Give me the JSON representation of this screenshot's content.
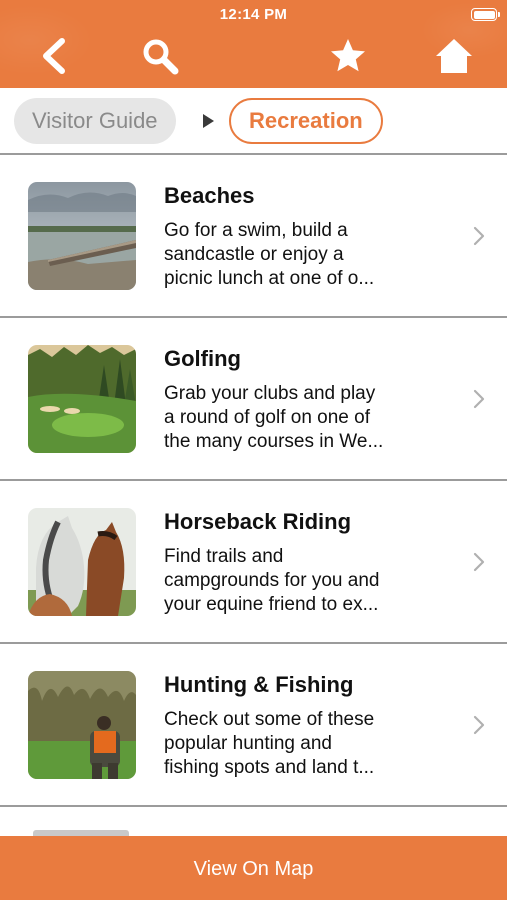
{
  "status": {
    "time": "12:14 PM"
  },
  "header": {
    "icons": [
      "back-chevron-icon",
      "search-icon",
      "star-icon",
      "home-icon"
    ],
    "color": "#e97b3f"
  },
  "breadcrumb": {
    "parent": "Visitor Guide",
    "current": "Recreation"
  },
  "items": [
    {
      "title": "Beaches",
      "desc_lines": [
        "Go for a swim, build a",
        "sandcastle or enjoy a",
        "picnic lunch at one of o..."
      ]
    },
    {
      "title": "Golfing",
      "desc_lines": [
        "Grab your clubs and play",
        "a round of golf on one of",
        "the many courses in We..."
      ]
    },
    {
      "title": "Horseback Riding",
      "desc_lines": [
        "Find trails and",
        "campgrounds for you and",
        "your equine friend to ex..."
      ]
    },
    {
      "title": "Hunting & Fishing",
      "desc_lines": [
        "Check out some of these",
        "popular hunting and",
        "fishing spots and land t..."
      ]
    }
  ],
  "bottom": {
    "label": "View On Map"
  }
}
